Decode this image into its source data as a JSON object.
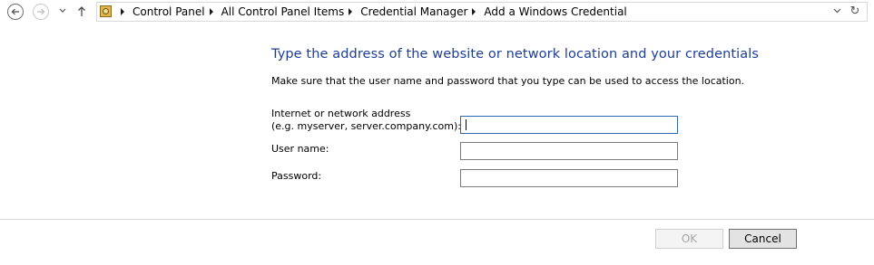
{
  "navigation": {
    "breadcrumbs": [
      "Control Panel",
      "All Control Panel Items",
      "Credential Manager",
      "Add a Windows Credential"
    ],
    "icons": {
      "back": "back-arrow-icon",
      "forward": "forward-arrow-icon",
      "recent": "chevron-down-icon",
      "up": "up-arrow-icon",
      "location": "control-panel-icon",
      "address_dropdown": "chevron-down-icon",
      "refresh": "refresh-icon"
    }
  },
  "form": {
    "heading": "Type the address of the website or network location and your credentials",
    "subtext": "Make sure that the user name and password that you type can be used to access the location.",
    "address_label_line1": "Internet or network address",
    "address_label_line2": "(e.g. myserver, server.company.com):",
    "address_value": "",
    "username_label": "User name:",
    "username_value": "",
    "password_label": "Password:",
    "password_value": ""
  },
  "buttons": {
    "ok": "OK",
    "cancel": "Cancel"
  },
  "colors": {
    "heading": "#1e3e96",
    "focus_border": "#2f69b1",
    "disabled_text": "#a6a6a6"
  }
}
